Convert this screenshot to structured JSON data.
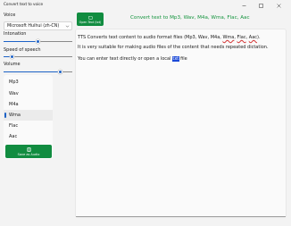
{
  "window": {
    "title": "Convert text to voice"
  },
  "controls": {
    "voice_label": "Voice",
    "voice_selected": "Microsoft Huihui (zh-CN)",
    "intonation_label": "Intonation",
    "intonation_value": 0.5,
    "speed_label": "Speed of speech",
    "speed_value": 0.1,
    "volume_label": "Volume",
    "volume_value": 0.85
  },
  "formats": {
    "items": [
      "Mp3",
      "Wav",
      "M4a",
      "Wma",
      "Flac",
      "Aac"
    ],
    "selected": "Wma"
  },
  "buttons": {
    "save_audio": "Save as Audio",
    "open_text": "Open Text (txt)"
  },
  "main": {
    "heading": "Convert text to Mp3, Wav, M4a, Wma, Flac, Aac",
    "line1_a": "TTS Converts text content to audio format files (Mp3, Wav, M4a, ",
    "line1_wma": "Wma",
    "line1_sep1": ", ",
    "line1_flac": "Flac",
    "line1_sep2": ", ",
    "line1_aac": "Aac",
    "line1_end": ").",
    "line2": "It is very suitable for making audio files of the content that needs repeated dictation.",
    "line3_a": "You can enter text directly or open a local ",
    "line3_txt": "txt",
    "line3_b": " file"
  },
  "colors": {
    "accent": "#1d62c6",
    "button_green": "#118c40",
    "heading_green": "#15943e",
    "selection_blue": "#1b49d7"
  }
}
